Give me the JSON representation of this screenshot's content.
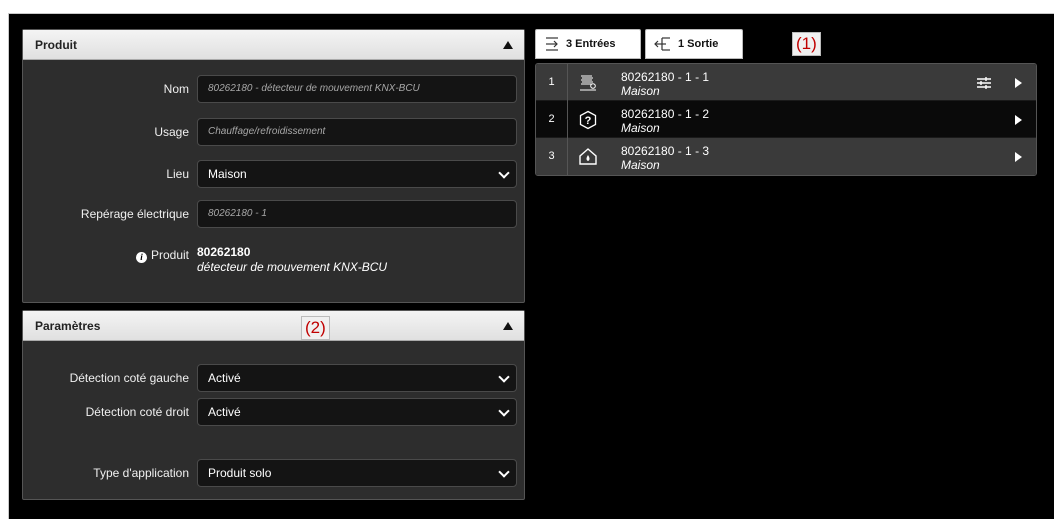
{
  "product_panel": {
    "title": "Produit",
    "fields": {
      "nom": {
        "label": "Nom",
        "value": "80262180 - détecteur de mouvement KNX-BCU"
      },
      "usage": {
        "label": "Usage",
        "value": "Chauffage/refroidissement"
      },
      "lieu": {
        "label": "Lieu",
        "value": "Maison"
      },
      "reperage": {
        "label": "Repérage électrique",
        "value": "80262180 - 1"
      },
      "produit": {
        "label": "Produit",
        "id": "80262180",
        "description": "détecteur de mouvement KNX-BCU"
      }
    }
  },
  "params_panel": {
    "title": "Paramètres",
    "fields": {
      "gauche": {
        "label": "Détection coté gauche",
        "value": "Activé"
      },
      "droit": {
        "label": "Détection coté droit",
        "value": "Activé"
      },
      "type": {
        "label": "Type d'application",
        "value": "Produit solo"
      }
    }
  },
  "callouts": {
    "one": "(1)",
    "two": "(2)"
  },
  "tabs": {
    "entrees": "3 Entrées",
    "sortie": "1 Sortie"
  },
  "channels": [
    {
      "num": "1",
      "name": "80262180 - 1 - 1",
      "location": "Maison",
      "icon": "heating-icon"
    },
    {
      "num": "2",
      "name": "80262180 - 1 - 2",
      "location": "Maison",
      "icon": "unknown-icon"
    },
    {
      "num": "3",
      "name": "80262180 - 1 - 3",
      "location": "Maison",
      "icon": "home-icon"
    }
  ]
}
